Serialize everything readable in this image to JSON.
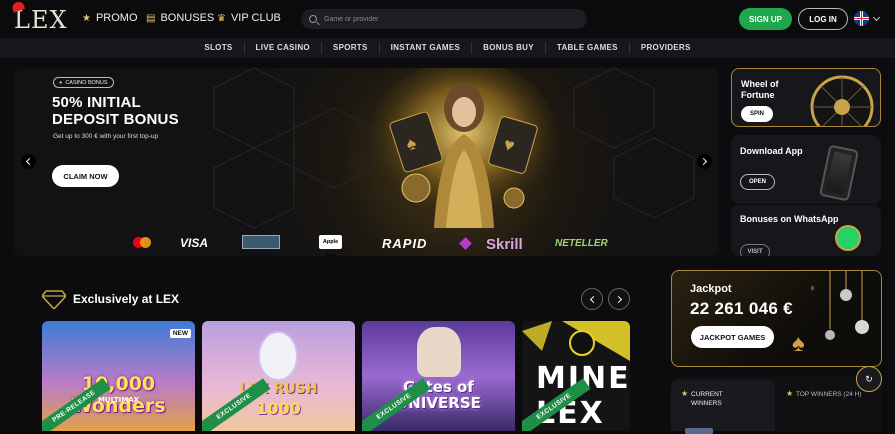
{
  "brand": {
    "logo_text": "LEX"
  },
  "topnav": [
    {
      "label": "PROMO",
      "icon": "star-icon"
    },
    {
      "label": "BONUSES",
      "icon": "gift-icon"
    },
    {
      "label": "VIP CLUB",
      "icon": "crown-icon"
    }
  ],
  "search": {
    "placeholder": "Game or provider"
  },
  "auth": {
    "signup_label": "SIGN UP",
    "login_label": "LOG IN"
  },
  "language": {
    "flag": "uk-flag-icon"
  },
  "categories": [
    "SLOTS",
    "LIVE CASINO",
    "SPORTS",
    "INSTANT GAMES",
    "BONUS BUY",
    "TABLE GAMES",
    "PROVIDERS"
  ],
  "hero": {
    "badge": "CASINO BONUS",
    "title": "50% INITIAL DEPOSIT BONUS",
    "subtitle": "Get up to 300 € with your first top-up",
    "cta": "CLAIM NOW",
    "payments": [
      "VISA",
      "Apple Pay",
      "RAPID",
      "Skrill",
      "NETELLER"
    ]
  },
  "side_cards": [
    {
      "title": "Wheel of Fortune",
      "button": "SPIN"
    },
    {
      "title": "Download App",
      "button": "OPEN"
    },
    {
      "title": "Bonuses on WhatsApp",
      "button": "VISIT"
    }
  ],
  "section": {
    "title": "Exclusively at LEX"
  },
  "games": [
    {
      "title": "10,000 Wonders",
      "subtitle": "MULTIMAX",
      "tag": "NEW",
      "ribbon": "PRE-RELEASE"
    },
    {
      "title": "LEX RUSH",
      "subtitle": "1000",
      "ribbon": "EXCLUSIVE"
    },
    {
      "title": "Gates of UNIVERSE",
      "ribbon": "EXCLUSIVE"
    },
    {
      "title": "MINE LEX",
      "ribbon": "EXCLUSIVE"
    }
  ],
  "jackpot": {
    "label": "Jackpot",
    "amount": "22 261 046 €",
    "button": "JACKPOT GAMES"
  },
  "winners_tabs": [
    {
      "label": "CURRENT WINNERS"
    },
    {
      "label": "TOP WINNERS (24 H)"
    }
  ],
  "colors": {
    "accent_green": "#1ea84b",
    "gold": "#c9a24a",
    "background": "#0c0c0f"
  }
}
